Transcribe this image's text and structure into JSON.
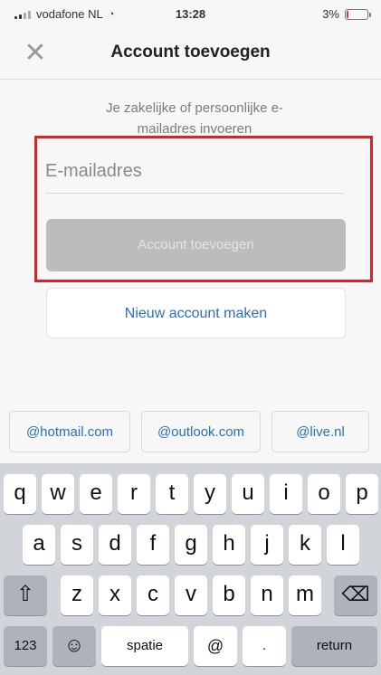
{
  "status_bar": {
    "carrier": "vodafone NL",
    "time": "13:28",
    "battery": "3%"
  },
  "navbar": {
    "close_glyph": "✕",
    "title": "Account toevoegen"
  },
  "main": {
    "instruction": "Je zakelijke of persoonlijke e-mailadres invoeren",
    "email_placeholder": "E-mailadres",
    "email_value": "",
    "add_account_label": "Account toevoegen",
    "new_account_label": "Nieuw account maken"
  },
  "suggestions": [
    "@hotmail.com",
    "@outlook.com",
    "@live.nl"
  ],
  "keyboard": {
    "row1": [
      "q",
      "w",
      "e",
      "r",
      "t",
      "y",
      "u",
      "i",
      "o",
      "p"
    ],
    "row2": [
      "a",
      "s",
      "d",
      "f",
      "g",
      "h",
      "j",
      "k",
      "l"
    ],
    "row3": [
      "z",
      "x",
      "c",
      "v",
      "b",
      "n",
      "m"
    ],
    "shift_glyph": "⇧",
    "backspace_glyph": "⌫",
    "numbers_label": "123",
    "emoji_glyph": "☺",
    "space_label": "spatie",
    "at_label": "@",
    "dot_label": ".",
    "return_label": "return"
  },
  "colors": {
    "highlight": "#d6242c",
    "link_blue": "#2a6fc0",
    "disabled_button": "#bcbcbc",
    "keyboard_bg": "#d1d4d9"
  }
}
